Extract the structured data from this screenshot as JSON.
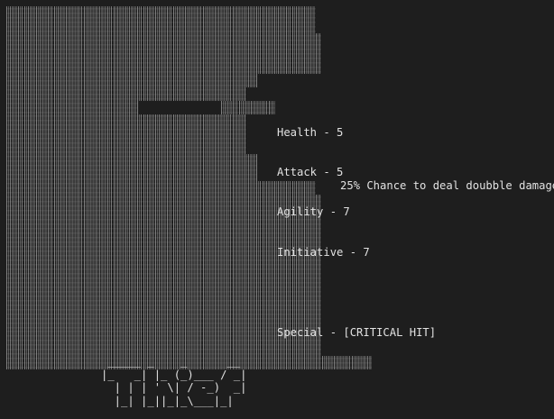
{
  "stats": {
    "health": "Health - 5",
    "attack": "Attack - 5",
    "agility": "Agility - 7",
    "initiative": "Initiative - 7",
    "special": "Special - [CRITICAL HIT]",
    "special_description": "25% Chance to deal doubble damage"
  },
  "banner": {
    "line1": " _____ _    _      __",
    "line2": "|_   _| |_ (_)___ / _|",
    "line3": "  | | | ' \\| / -_)  _|",
    "line4": "  |_| |_||_|_\\___|_|"
  },
  "colors": {
    "background": "#1e1e1e",
    "text": "#e2e2e2",
    "art": "#c8c8c8"
  }
}
